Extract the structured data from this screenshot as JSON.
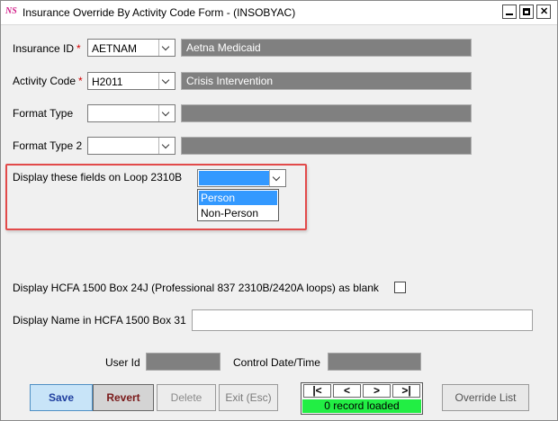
{
  "window": {
    "app_icon": "NS",
    "title": "Insurance Override By Activity Code Form - (INSOBYAC)"
  },
  "form": {
    "insurance_id": {
      "label": "Insurance ID",
      "required": "*",
      "value": "AETNAM",
      "description": "Aetna Medicaid"
    },
    "activity_code": {
      "label": "Activity Code",
      "required": "*",
      "value": "H2011",
      "description": "Crisis Intervention"
    },
    "format_type": {
      "label": "Format Type",
      "value": "",
      "description": ""
    },
    "format_type_2": {
      "label": "Format Type 2",
      "value": "",
      "description": ""
    },
    "loop_2310b": {
      "label": "Display these fields on Loop 2310B",
      "options": [
        "Person",
        "Non-Person"
      ],
      "highlighted_option": "Person"
    },
    "hcfa_box24j": {
      "label": "Display HCFA 1500 Box 24J (Professional 837 2310B/2420A loops) as blank",
      "checked": false
    },
    "hcfa_box31": {
      "label": "Display Name in HCFA 1500 Box 31",
      "value": ""
    },
    "user_id": {
      "label": "User Id",
      "value": ""
    },
    "control_date": {
      "label": "Control Date/Time",
      "value": ""
    }
  },
  "buttons": {
    "save": "Save",
    "revert": "Revert",
    "delete": "Delete",
    "exit": "Exit (Esc)",
    "override_list": "Override List"
  },
  "navigator": {
    "first": "|<",
    "prev": "<",
    "next": ">",
    "last": ">|",
    "status": "0 record loaded"
  },
  "colors": {
    "highlight_border": "#e24a4a",
    "selection": "#3399ff",
    "status_bar": "#22ee44",
    "readonly_field": "#808080"
  }
}
